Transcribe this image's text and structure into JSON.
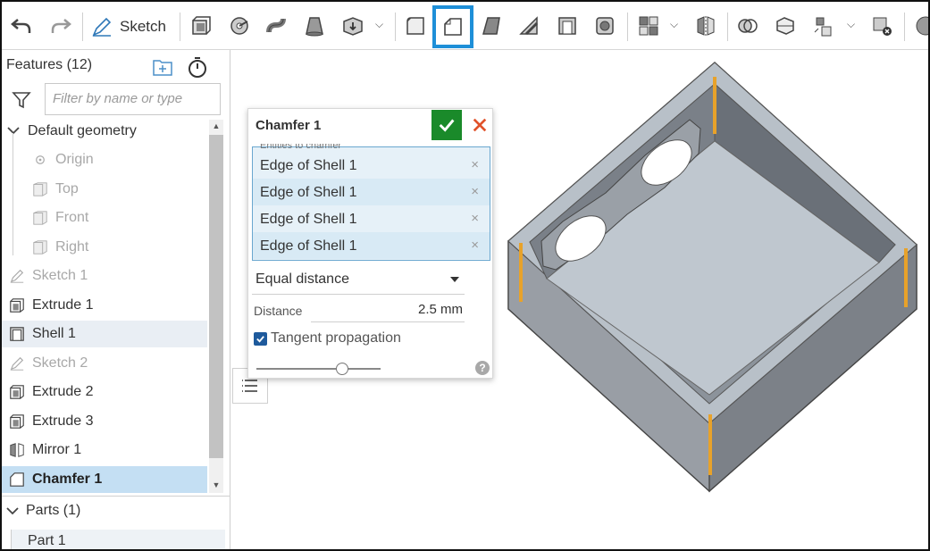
{
  "toolbar": {
    "sketch_label": "Sketch",
    "items": [
      "undo-icon",
      "redo-icon",
      "sketch-icon",
      "extrude-icon",
      "revolve-icon",
      "sweep-icon",
      "loft-icon",
      "thicken-icon",
      "fillet-icon",
      "chamfer-icon",
      "draft-icon",
      "rib-icon",
      "shell-icon",
      "hole-icon",
      "pattern-icon",
      "mirror-icon",
      "boolean-icon",
      "split-icon",
      "transform-icon",
      "delete-part-icon",
      "view-cube-icon"
    ],
    "selected": "chamfer-icon",
    "accent": "#1e8fd8"
  },
  "features": {
    "header": "Features (12)",
    "filter_placeholder": "Filter by name or type",
    "default_geometry_label": "Default geometry",
    "items": [
      {
        "label": "Origin",
        "icon": "origin-icon",
        "state": "dim"
      },
      {
        "label": "Top",
        "icon": "plane-icon",
        "state": "dim"
      },
      {
        "label": "Front",
        "icon": "plane-icon",
        "state": "dim"
      },
      {
        "label": "Right",
        "icon": "plane-icon",
        "state": "dim"
      },
      {
        "label": "Sketch 1",
        "icon": "sketch-icon",
        "state": "dim"
      },
      {
        "label": "Extrude 1",
        "icon": "extrude-icon",
        "state": "normal"
      },
      {
        "label": "Shell 1",
        "icon": "shell-icon",
        "state": "selected"
      },
      {
        "label": "Sketch 2",
        "icon": "sketch-icon",
        "state": "dim"
      },
      {
        "label": "Extrude 2",
        "icon": "extrude-icon",
        "state": "normal"
      },
      {
        "label": "Extrude 3",
        "icon": "extrude-icon",
        "state": "normal"
      },
      {
        "label": "Mirror 1",
        "icon": "mirror-icon",
        "state": "normal"
      },
      {
        "label": "Chamfer 1",
        "icon": "chamfer-icon",
        "state": "active"
      }
    ]
  },
  "parts": {
    "header": "Parts (1)",
    "items": [
      "Part 1"
    ]
  },
  "dialog": {
    "title": "Chamfer 1",
    "entities_label": "Entities to chamfer",
    "entities": [
      "Edge of Shell 1",
      "Edge of Shell 1",
      "Edge of Shell 1",
      "Edge of Shell 1"
    ],
    "remove_glyph": "×",
    "chamfer_type": "Equal distance",
    "distance_label": "Distance",
    "distance_value": "2.5 mm",
    "tangent_label": "Tangent propagation",
    "tangent_checked": true,
    "help_glyph": "?",
    "confirm_color": "#1a8a2a",
    "cancel_color": "#e0522a"
  },
  "model": {
    "body_color": "#8d9299",
    "highlight_edge_color": "#e8a22a"
  }
}
